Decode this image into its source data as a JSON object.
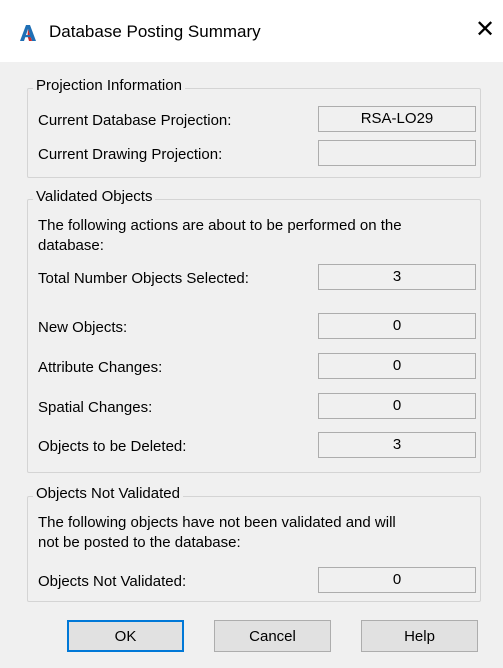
{
  "window": {
    "title": "Database Posting Summary",
    "close_glyph": "✕",
    "app_icon": "autocad-a-icon",
    "accent": "#0078d7"
  },
  "projection": {
    "title": "Projection Information",
    "current_db_label": "Current Database Projection:",
    "current_db_value": "RSA-LO29",
    "current_drawing_label": "Current Drawing Projection:",
    "current_drawing_value": ""
  },
  "validated": {
    "title": "Validated Objects",
    "description_line1": "The following actions are about to be performed on the",
    "description_line2": "database:",
    "rows": [
      {
        "label": "Total Number Objects Selected:",
        "value": "3"
      },
      {
        "label": "New Objects:",
        "value": "0"
      },
      {
        "label": "Attribute Changes:",
        "value": "0"
      },
      {
        "label": "Spatial Changes:",
        "value": "0"
      },
      {
        "label": "Objects to be Deleted:",
        "value": "3"
      }
    ]
  },
  "not_validated": {
    "title": "Objects Not Validated",
    "description_line1": "The following objects have not been validated and will",
    "description_line2": "not be posted to the database:",
    "label": "Objects Not Validated:",
    "value": "0"
  },
  "buttons": {
    "ok": "OK",
    "cancel": "Cancel",
    "help": "Help"
  }
}
